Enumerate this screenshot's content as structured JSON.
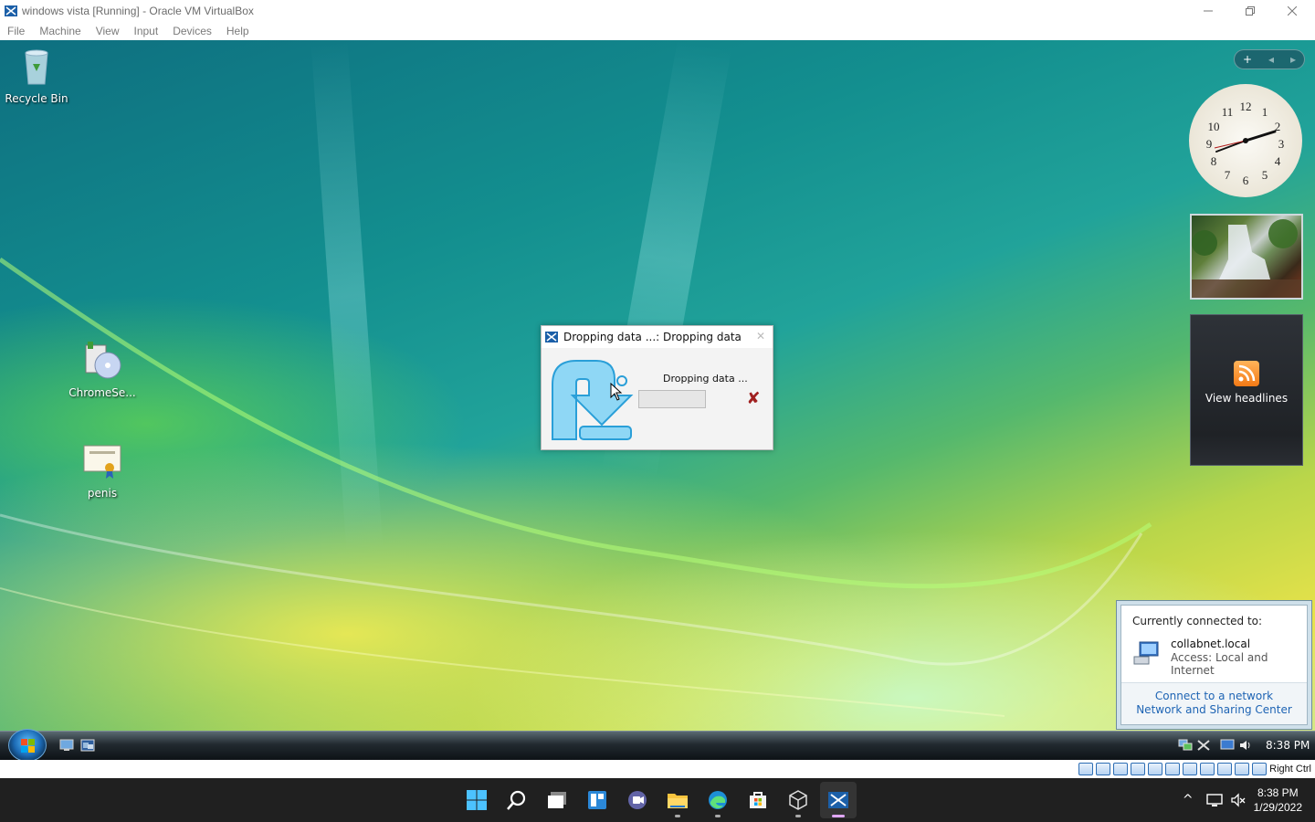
{
  "window": {
    "title": "windows vista [Running] - Oracle VM VirtualBox",
    "menu": [
      "File",
      "Machine",
      "View",
      "Input",
      "Devices",
      "Help"
    ]
  },
  "desktop": {
    "icons": [
      {
        "label": "Recycle Bin"
      },
      {
        "label": "ChromeSe..."
      },
      {
        "label": "penis"
      }
    ]
  },
  "sidebar": {
    "controls": [
      "+",
      "◂",
      "▸"
    ],
    "clock": {
      "hour_labels": [
        "12",
        "1",
        "2",
        "3",
        "4",
        "5",
        "6",
        "7",
        "8",
        "9",
        "10",
        "11"
      ]
    },
    "feed": {
      "label": "View headlines"
    }
  },
  "drop_dialog": {
    "title": "Dropping data ...: Dropping data",
    "message": "Dropping data ...",
    "progress": 0.0,
    "close_glyph": "✕",
    "cancel_glyph": "✘"
  },
  "network_flyout": {
    "header": "Currently connected to:",
    "network_name": "collabnet.local",
    "access": "Access:  Local and Internet",
    "links": [
      "Connect to a network",
      "Network and Sharing Center"
    ]
  },
  "vista_taskbar": {
    "time": "8:38 PM"
  },
  "vb_status": {
    "host_key": "Right Ctrl"
  },
  "host_taskbar": {
    "time": "8:38 PM",
    "date": "1/29/2022",
    "tray_chevron": "^"
  },
  "colors": {
    "progress_fill": "#06b025",
    "link": "#1e64b4",
    "active_indicator": "#e1a7ff"
  }
}
